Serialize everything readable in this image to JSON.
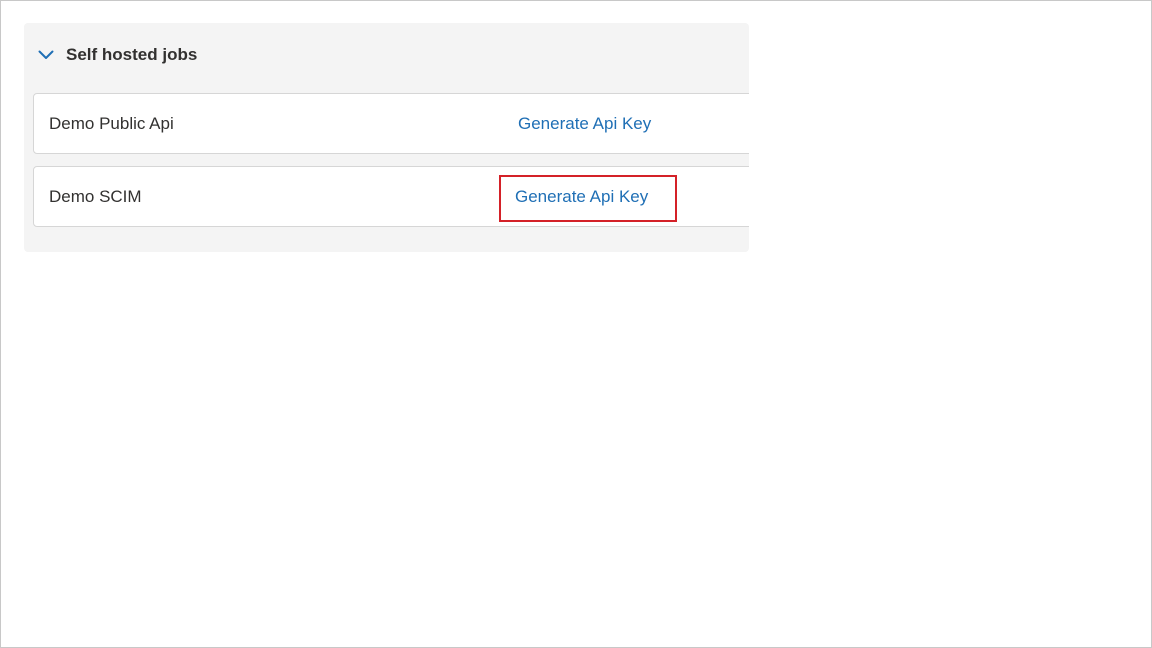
{
  "section": {
    "title": "Self hosted jobs",
    "expanded": true,
    "icon": "chevron-down-icon"
  },
  "jobs": [
    {
      "name": "Demo Public Api",
      "action_label": "Generate Api Key"
    },
    {
      "name": "Demo SCIM",
      "action_label": "Generate Api Key"
    }
  ],
  "colors": {
    "link": "#1f6fb5",
    "highlight": "#d42128",
    "panel_bg": "#f4f4f4"
  }
}
